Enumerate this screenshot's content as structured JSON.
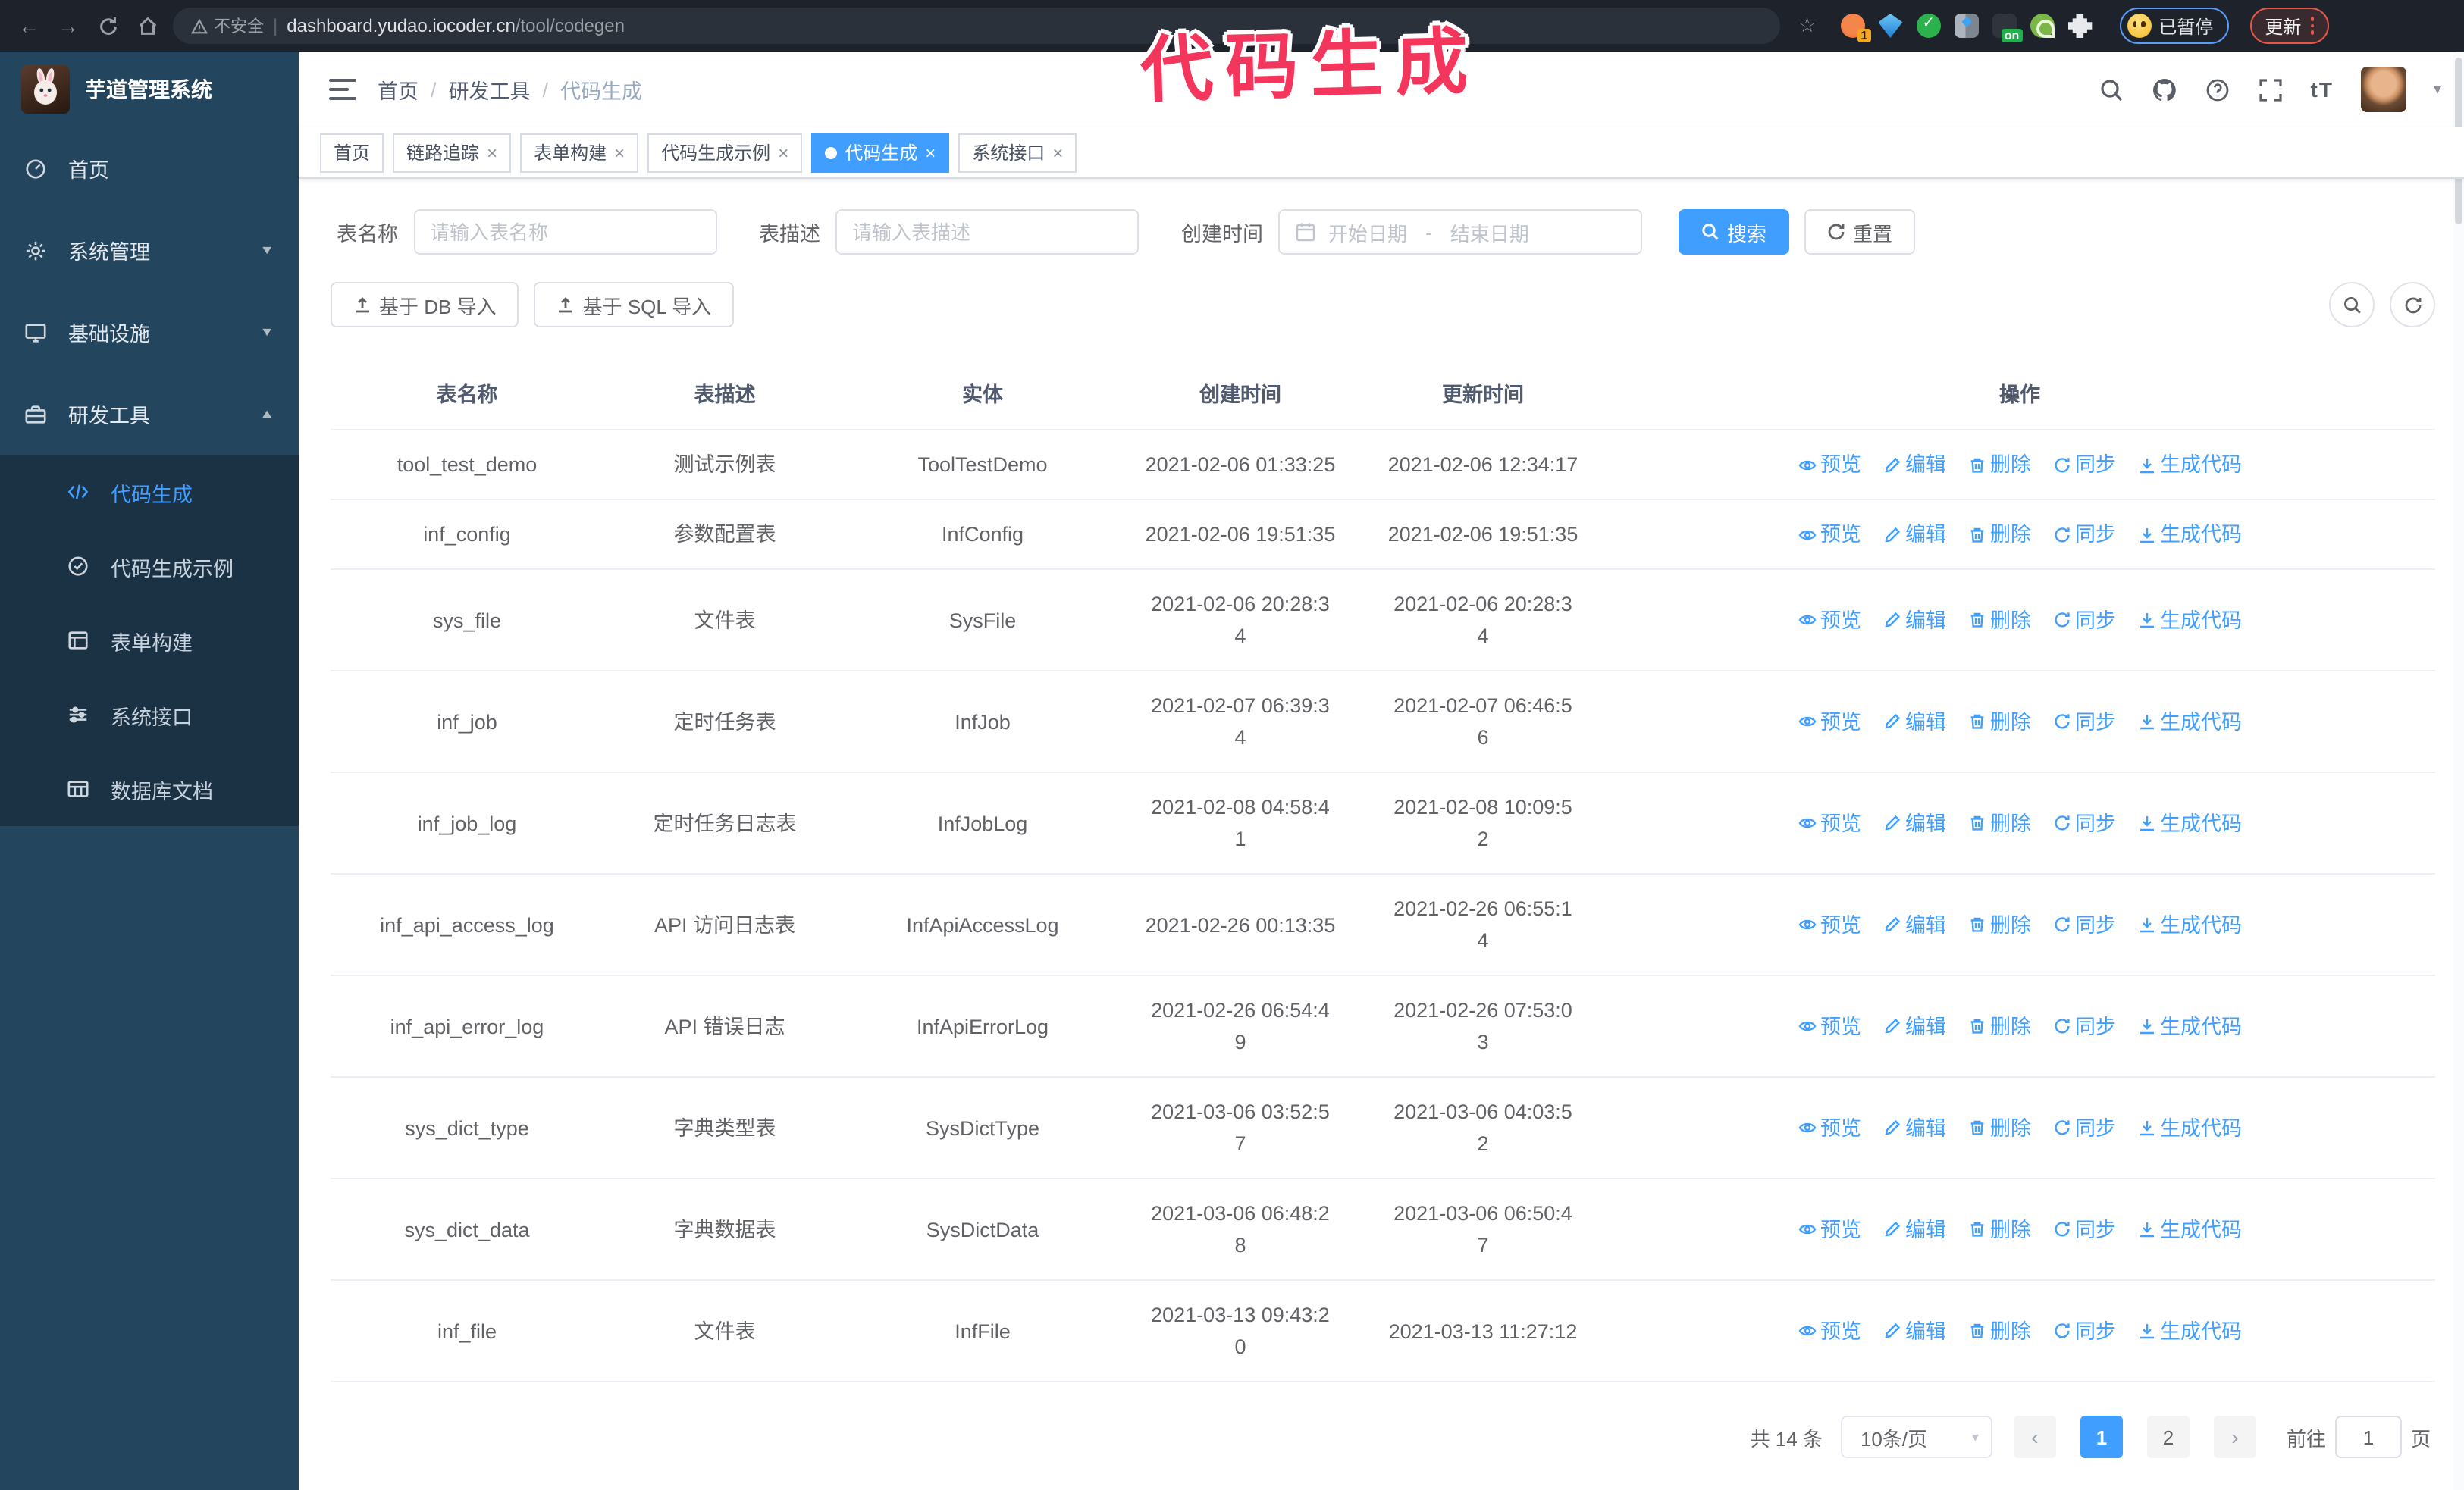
{
  "browser": {
    "security_label": "不安全",
    "url_domain": "dashboard.yudao.iocoder.cn",
    "url_path": "/tool/codegen",
    "extension_badge_1": "1",
    "extension_badge_on": "on",
    "paused_badge": "已暂停",
    "update_button": "更新"
  },
  "annotation": {
    "text": "代码生成",
    "color": "#f4365c"
  },
  "icons": {
    "star": "☆",
    "caret": "▾",
    "close": "×",
    "prev": "‹",
    "next": "›",
    "back": "←",
    "forward": "→",
    "font_size": "tT",
    "breadcrumb_separator": "/",
    "date_separator": "-"
  },
  "app": {
    "title": "芋道管理系统",
    "breadcrumb": {
      "0": "首页",
      "1": "研发工具",
      "2": "代码生成"
    }
  },
  "sidebar": {
    "items": {
      "home": "首页",
      "system": "系统管理",
      "infra": "基础设施",
      "devtools": "研发工具"
    },
    "submenu": {
      "codegen": "代码生成",
      "codegen_demo": "代码生成示例",
      "form_builder": "表单构建",
      "system_api": "系统接口",
      "db_doc": "数据库文档"
    }
  },
  "tags": {
    "0": "首页",
    "1": "链路追踪",
    "2": "表单构建",
    "3": "代码生成示例",
    "4": "代码生成",
    "5": "系统接口"
  },
  "search_form": {
    "table_name_label": "表名称",
    "table_name_placeholder": "请输入表名称",
    "table_desc_label": "表描述",
    "table_desc_placeholder": "请输入表描述",
    "create_time_label": "创建时间",
    "date_start_placeholder": "开始日期",
    "date_end_placeholder": "结束日期",
    "search_label": "搜索",
    "reset_label": "重置"
  },
  "toolbar": {
    "import_db_label": "基于 DB 导入",
    "import_sql_label": "基于 SQL 导入"
  },
  "table": {
    "columns": [
      "表名称",
      "表描述",
      "实体",
      "创建时间",
      "更新时间",
      "操作"
    ],
    "actions": [
      "预览",
      "编辑",
      "删除",
      "同步",
      "生成代码"
    ],
    "rows": [
      {
        "name": "tool_test_demo",
        "desc": "测试示例表",
        "entity": "ToolTestDemo",
        "create_time": "2021-02-06 01:33:25",
        "update_time": "2021-02-06 12:34:17"
      },
      {
        "name": "inf_config",
        "desc": "参数配置表",
        "entity": "InfConfig",
        "create_time": "2021-02-06 19:51:35",
        "update_time": "2021-02-06 19:51:35"
      },
      {
        "name": "sys_file",
        "desc": "文件表",
        "entity": "SysFile",
        "create_time": "2021-02-06 20:28:3\n4",
        "update_time": "2021-02-06 20:28:3\n4"
      },
      {
        "name": "inf_job",
        "desc": "定时任务表",
        "entity": "InfJob",
        "create_time": "2021-02-07 06:39:3\n4",
        "update_time": "2021-02-07 06:46:5\n6"
      },
      {
        "name": "inf_job_log",
        "desc": "定时任务日志表",
        "entity": "InfJobLog",
        "create_time": "2021-02-08 04:58:4\n1",
        "update_time": "2021-02-08 10:09:5\n2"
      },
      {
        "name": "inf_api_access_log",
        "desc": "API 访问日志表",
        "entity": "InfApiAccessLog",
        "create_time": "2021-02-26 00:13:35",
        "update_time": "2021-02-26 06:55:1\n4"
      },
      {
        "name": "inf_api_error_log",
        "desc": "API 错误日志",
        "entity": "InfApiErrorLog",
        "create_time": "2021-02-26 06:54:4\n9",
        "update_time": "2021-02-26 07:53:0\n3"
      },
      {
        "name": "sys_dict_type",
        "desc": "字典类型表",
        "entity": "SysDictType",
        "create_time": "2021-03-06 03:52:5\n7",
        "update_time": "2021-03-06 04:03:5\n2"
      },
      {
        "name": "sys_dict_data",
        "desc": "字典数据表",
        "entity": "SysDictData",
        "create_time": "2021-03-06 06:48:2\n8",
        "update_time": "2021-03-06 06:50:4\n7"
      },
      {
        "name": "inf_file",
        "desc": "文件表",
        "entity": "InfFile",
        "create_time": "2021-03-13 09:43:2\n0",
        "update_time": "2021-03-13 11:27:12"
      }
    ]
  },
  "pagination": {
    "total_label": "共 14 条",
    "page_size_label": "10条/页",
    "page_1": "1",
    "page_2": "2",
    "jump_prefix": "前往",
    "jump_value": "1",
    "jump_suffix": "页"
  },
  "colors": {
    "accent": "#409eff",
    "sidebar": "#24455e",
    "submenu": "#1b3144",
    "annotation": "#f4365c"
  }
}
